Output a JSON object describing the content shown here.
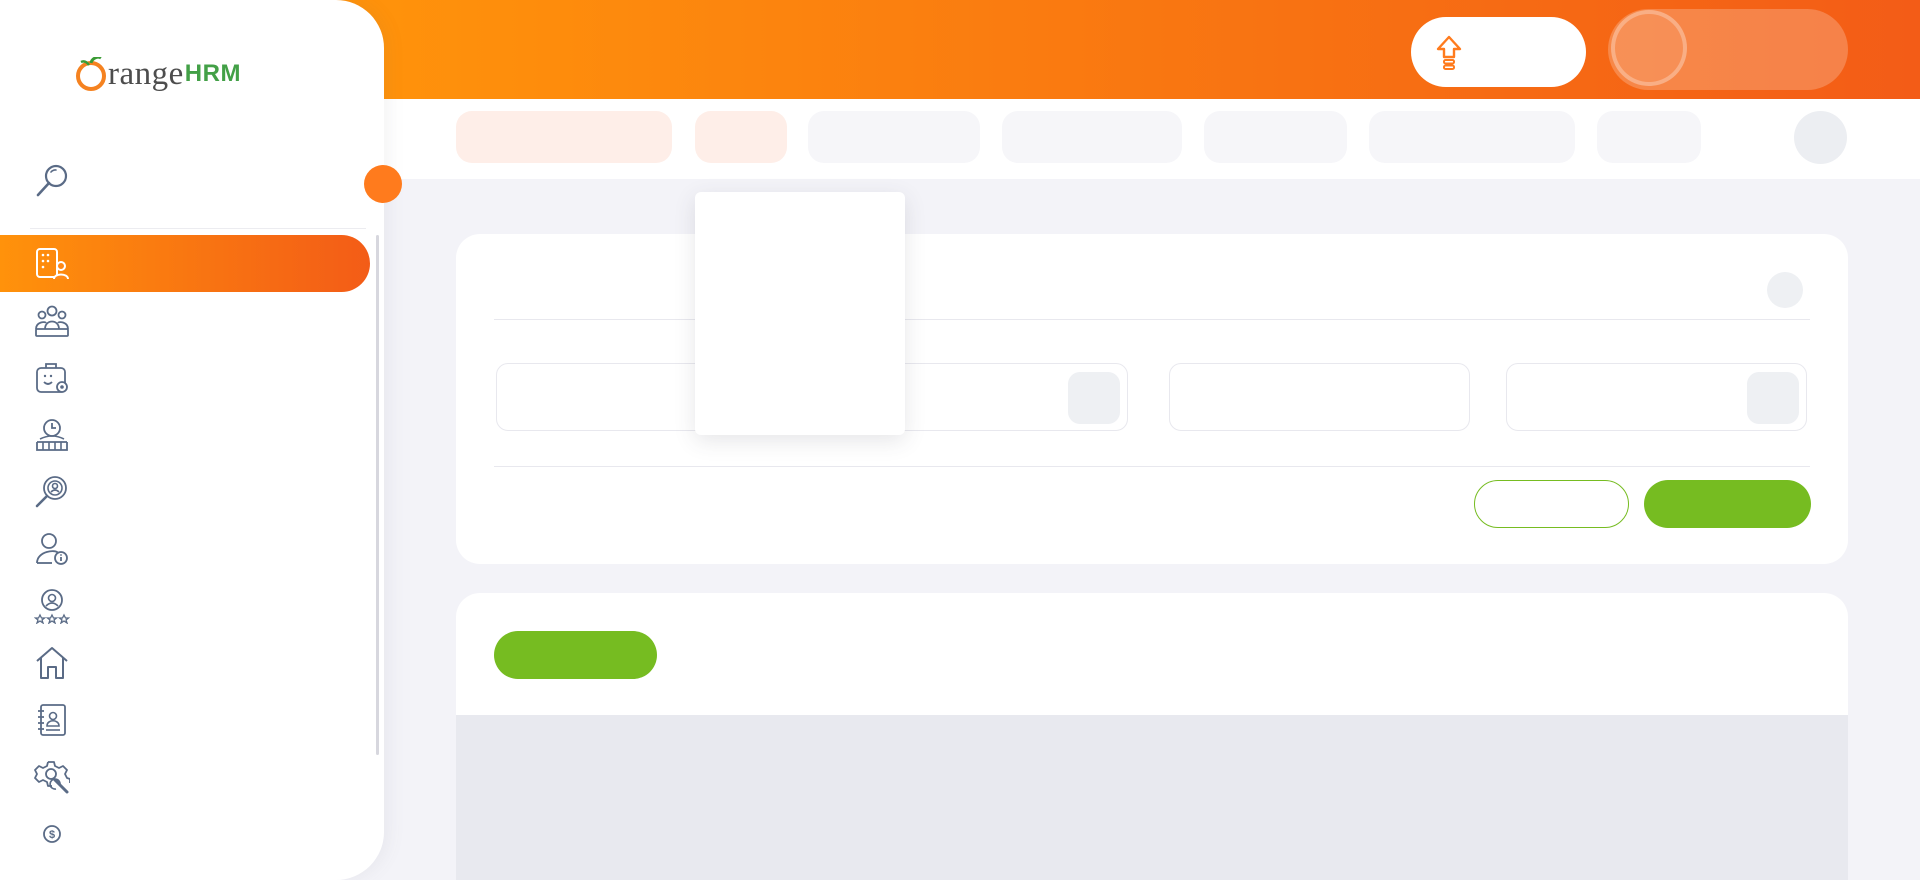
{
  "brand": {
    "name_orange": "range",
    "name_green": "HRM",
    "logo": "orangehrm-logo",
    "accent_color": "#ff7b1d",
    "primary_green": "#76bc21"
  },
  "header": {
    "upgrade_icon": "upgrade-arrow-icon",
    "user_avatar": "user-avatar"
  },
  "sidebar": {
    "search_icon": "search-icon",
    "items": [
      {
        "icon": "admin-icon",
        "active": true
      },
      {
        "icon": "pim-icon",
        "active": false
      },
      {
        "icon": "leave-icon",
        "active": false
      },
      {
        "icon": "time-icon",
        "active": false
      },
      {
        "icon": "recruitment-icon",
        "active": false
      },
      {
        "icon": "my-info-icon",
        "active": false
      },
      {
        "icon": "performance-icon",
        "active": false
      },
      {
        "icon": "dashboard-icon",
        "active": false
      },
      {
        "icon": "directory-icon",
        "active": false
      },
      {
        "icon": "maintenance-icon",
        "active": false
      },
      {
        "icon": "buzz-icon",
        "active": false
      }
    ]
  },
  "topnav": {
    "tabs_count": 7,
    "active_tabs": [
      0,
      1
    ]
  }
}
